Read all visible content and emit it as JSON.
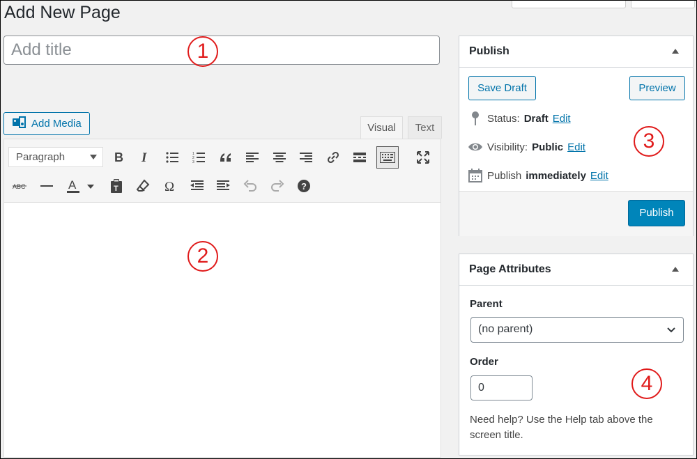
{
  "header": {
    "title": "Add New Page"
  },
  "title_field": {
    "placeholder": "Add title"
  },
  "annotations": {
    "one": "1",
    "two": "2",
    "three": "3",
    "four": "4"
  },
  "media": {
    "add_media_label": "Add Media"
  },
  "tabs": {
    "visual": "Visual",
    "text": "Text"
  },
  "toolbar": {
    "format_select": "Paragraph",
    "row1_icons": [
      "bold-icon",
      "italic-icon",
      "bullet-list-icon",
      "numbered-list-icon",
      "blockquote-icon",
      "align-left-icon",
      "align-center-icon",
      "align-right-icon",
      "link-icon",
      "read-more-icon",
      "toolbar-toggle-icon",
      "fullscreen-icon"
    ],
    "row2_icons": [
      "strikethrough-icon",
      "horizontal-line-icon",
      "text-color-icon",
      "paste-text-icon",
      "clear-formatting-icon",
      "special-character-icon",
      "outdent-icon",
      "indent-icon",
      "undo-icon",
      "redo-icon",
      "help-icon"
    ]
  },
  "publish_box": {
    "title": "Publish",
    "save_draft": "Save Draft",
    "preview": "Preview",
    "status_label": "Status:",
    "status_value": "Draft",
    "visibility_label": "Visibility:",
    "visibility_value": "Public",
    "publish_label": "Publish",
    "publish_value": "immediately",
    "edit": "Edit",
    "publish_button": "Publish"
  },
  "attributes_box": {
    "title": "Page Attributes",
    "parent_label": "Parent",
    "parent_value": "(no parent)",
    "order_label": "Order",
    "order_value": "0",
    "help_line1": "Need help? Use the Help tab above the",
    "help_line2": "screen title."
  },
  "colors": {
    "accent": "#0073aa",
    "primary": "#0085ba",
    "annotation": "#e01a1a"
  }
}
